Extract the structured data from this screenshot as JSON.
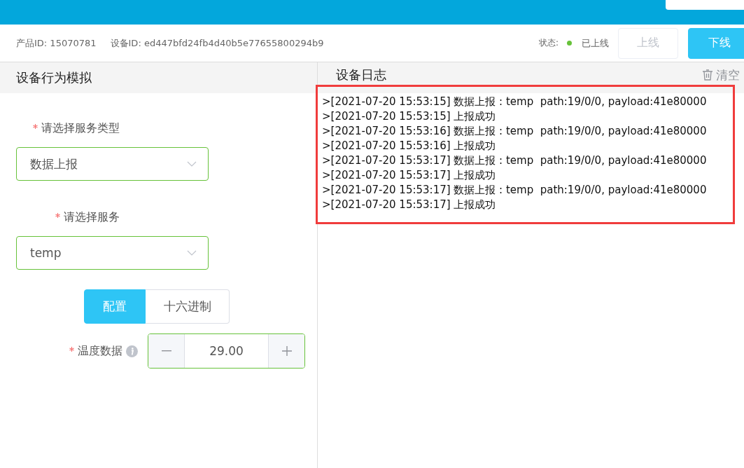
{
  "info": {
    "product": "产品ID: 15070781",
    "device": "设备ID: ed447bfd24fb4d40b5e77655800294b9"
  },
  "status": {
    "label": "状态:",
    "online": true,
    "text": "已上线"
  },
  "buttons": [
    {
      "label": "上线",
      "disabled": true
    },
    {
      "label": "下线",
      "disabled": false
    }
  ],
  "left_panel": {
    "title": "设备行为模拟",
    "fields": [
      {
        "kind": "select",
        "label": "请选择服务类型",
        "required": true,
        "value": "数据上报"
      },
      {
        "kind": "select",
        "label": "请选择服务",
        "required": true,
        "value": "temp"
      },
      {
        "kind": "segmented",
        "options": [
          {
            "label": "配置",
            "selected": true
          },
          {
            "label": "十六进制",
            "selected": false
          }
        ]
      },
      {
        "kind": "number",
        "label": "温度数据",
        "required": true,
        "info": true,
        "value": "29.00"
      }
    ]
  },
  "log": {
    "title": "设备日志",
    "clear": "清空",
    "lines": [
      ">[2021-07-20 15:53:15] 数据上报 : temp  path:19/0/0, payload:41e80000",
      ">[2021-07-20 15:53:15] 上报成功",
      ">[2021-07-20 15:53:16] 数据上报 : temp  path:19/0/0, payload:41e80000",
      ">[2021-07-20 15:53:16] 上报成功",
      ">[2021-07-20 15:53:17] 数据上报 : temp  path:19/0/0, payload:41e80000",
      ">[2021-07-20 15:53:17] 上报成功",
      ">[2021-07-20 15:53:17] 数据上报 : temp  path:19/0/0, payload:41e80000",
      ">[2021-07-20 15:53:17] 上报成功"
    ]
  }
}
